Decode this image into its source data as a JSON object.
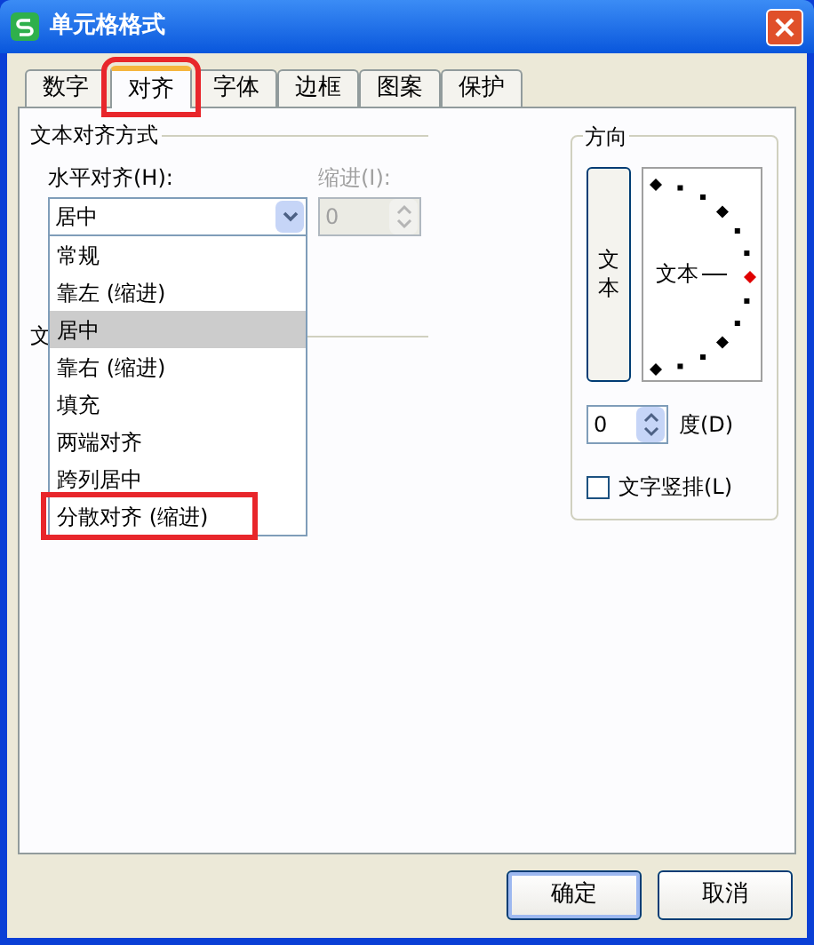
{
  "window": {
    "title": "单元格格式"
  },
  "tabs": [
    {
      "label": "数字",
      "selected": false,
      "highlighted": false
    },
    {
      "label": "对齐",
      "selected": true,
      "highlighted": true
    },
    {
      "label": "字体",
      "selected": false,
      "highlighted": false
    },
    {
      "label": "边框",
      "selected": false,
      "highlighted": false
    },
    {
      "label": "图案",
      "selected": false,
      "highlighted": false
    },
    {
      "label": "保护",
      "selected": false,
      "highlighted": false
    }
  ],
  "text_alignment": {
    "title": "文本对齐方式",
    "horizontal": {
      "label": "水平对齐(H):",
      "value": "居中",
      "options": [
        {
          "label": "常规",
          "selected": false,
          "highlighted": false
        },
        {
          "label": "靠左 (缩进)",
          "selected": false,
          "highlighted": false
        },
        {
          "label": "居中",
          "selected": true,
          "highlighted": false
        },
        {
          "label": "靠右 (缩进)",
          "selected": false,
          "highlighted": false
        },
        {
          "label": "填充",
          "selected": false,
          "highlighted": false
        },
        {
          "label": "两端对齐",
          "selected": false,
          "highlighted": false
        },
        {
          "label": "跨列居中",
          "selected": false,
          "highlighted": false
        },
        {
          "label": "分散对齐 (缩进)",
          "selected": false,
          "highlighted": true
        }
      ]
    },
    "indent": {
      "label": "缩进(I):",
      "value": "0",
      "disabled": true
    }
  },
  "text_control": {
    "title": "文"
  },
  "orientation": {
    "title": "方向",
    "vertical_text_button": "文本",
    "dial_label": "文本",
    "degrees": {
      "value": "0",
      "label": "度(D)"
    },
    "vertical_text": {
      "label": "文字竖排(L)",
      "checked": false
    }
  },
  "buttons": [
    {
      "label": "确定",
      "default": true
    },
    {
      "label": "取消",
      "default": false
    }
  ]
}
